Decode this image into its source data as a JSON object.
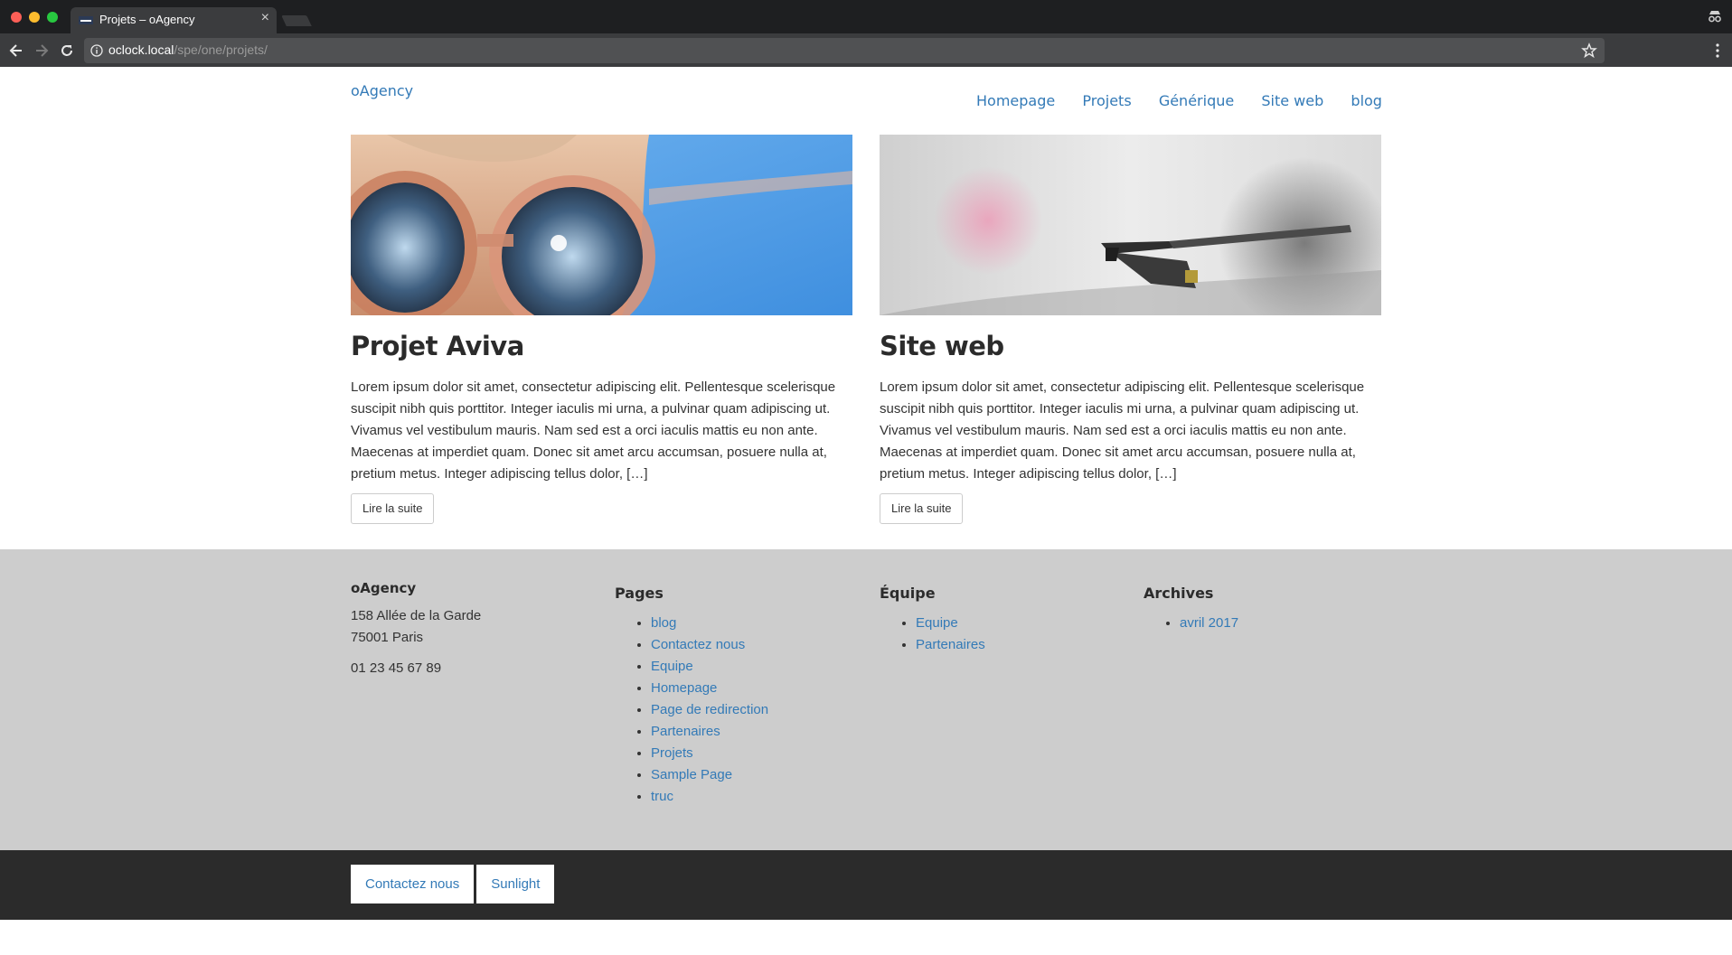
{
  "browser": {
    "tab_title": "Projets – oAgency",
    "url_host": "oclock.local",
    "url_path": "/spe/one/projets/"
  },
  "site": {
    "logo": "oAgency",
    "nav": [
      "Homepage",
      "Projets",
      "Générique",
      "Site web",
      "blog"
    ]
  },
  "projects": [
    {
      "title": "Projet Aviva",
      "image": "sunglasses-photo",
      "excerpt": "Lorem ipsum dolor sit amet, consectetur adipiscing elit. Pellentesque scelerisque suscipit nibh quis porttitor. Integer iaculis mi urna, a pulvinar quam adipiscing ut. Vivamus vel vestibulum mauris. Nam sed est a orci iaculis mattis eu non ante. Maecenas at imperdiet quam. Donec sit amet arcu accumsan, posuere nulla at, pretium metus. Integer adipiscing tellus dolor, […]",
      "button": "Lire la suite"
    },
    {
      "title": "Site web",
      "image": "turntable-photo",
      "excerpt": "Lorem ipsum dolor sit amet, consectetur adipiscing elit. Pellentesque scelerisque suscipit nibh quis porttitor. Integer iaculis mi urna, a pulvinar quam adipiscing ut. Vivamus vel vestibulum mauris. Nam sed est a orci iaculis mattis eu non ante. Maecenas at imperdiet quam. Donec sit amet arcu accumsan, posuere nulla at, pretium metus. Integer adipiscing tellus dolor, […]",
      "button": "Lire la suite"
    }
  ],
  "footer": {
    "brand": "oAgency",
    "address_line1": "158 Allée de la Garde",
    "address_line2": "75001 Paris",
    "phone": "01 23 45 67 89",
    "pages": {
      "heading": "Pages",
      "items": [
        "blog",
        "Contactez nous",
        "Equipe",
        "Homepage",
        "Page de redirection",
        "Partenaires",
        "Projets",
        "Sample Page",
        "truc"
      ]
    },
    "equipe": {
      "heading": "Équipe",
      "items": [
        "Equipe",
        "Partenaires"
      ]
    },
    "archives": {
      "heading": "Archives",
      "items": [
        "avril 2017"
      ]
    }
  },
  "bottom_nav": [
    "Contactez nous",
    "Sunlight"
  ],
  "colors": {
    "link": "#337ab7",
    "footer_bg": "#cdcdcd",
    "bottom_bar_bg": "#2b2b2b"
  }
}
